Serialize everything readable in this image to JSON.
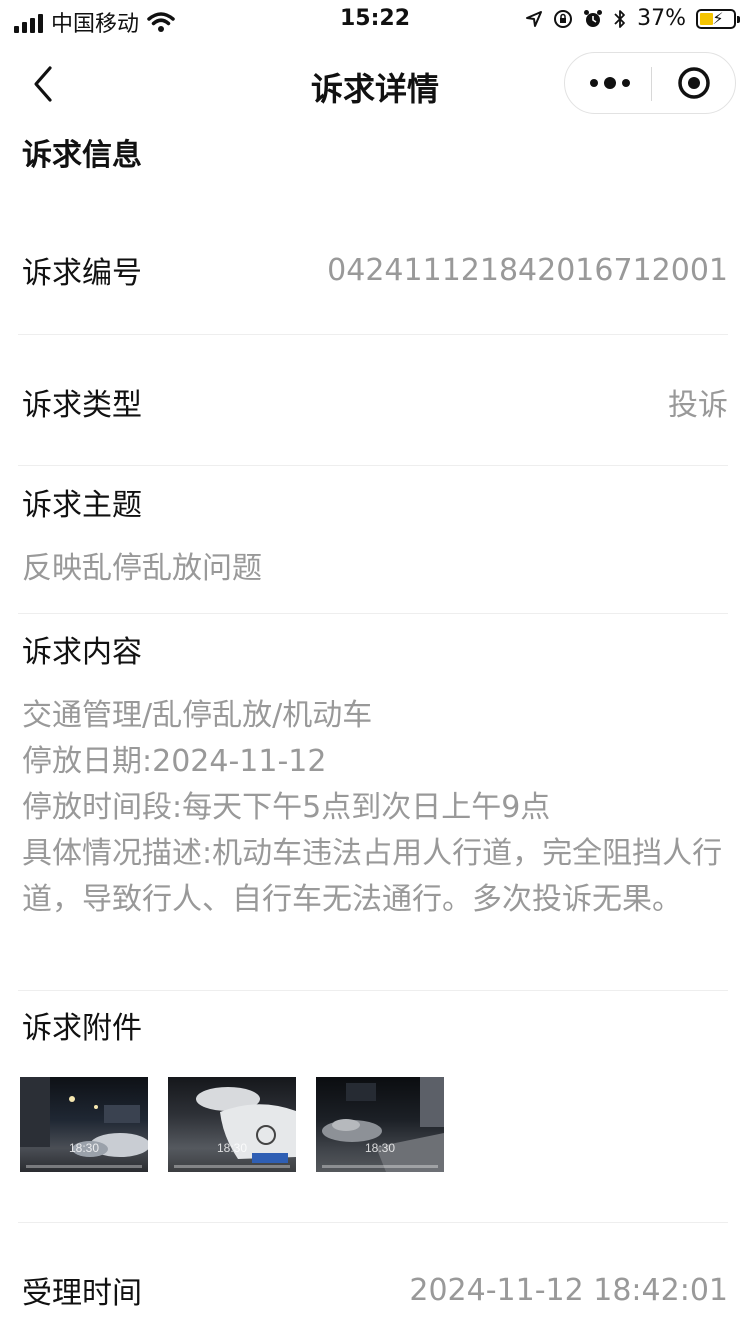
{
  "status_bar": {
    "carrier": "中国移动",
    "time": "15:22",
    "battery": "37%"
  },
  "nav": {
    "title": "诉求详情"
  },
  "section": {
    "title": "诉求信息"
  },
  "fields": {
    "number_label": "诉求编号",
    "number_value": "042411121842016712001",
    "type_label": "诉求类型",
    "type_value": "投诉",
    "theme_label": "诉求主题",
    "theme_value": "反映乱停乱放问题",
    "content_label": "诉求内容",
    "content_lines": [
      "交通管理/乱停乱放/机动车",
      "停放日期:2024-11-12",
      "停放时间段:每天下午5点到次日上午9点",
      "具体情况描述:机动车违法占用人行道，完全阻挡人行道，导致行人、自行车无法通行。多次投诉无果。"
    ],
    "attachments_label": "诉求附件",
    "accept_time_label": "受理时间",
    "accept_time_value": "2024-11-12 18:42:01"
  },
  "attachments": [
    {
      "time": "18:30"
    },
    {
      "time": "18:30"
    },
    {
      "time": "18:30"
    }
  ],
  "colors": {
    "label": "#111111",
    "value": "#999999",
    "separator": "#eeeeee",
    "battery_fill": "#f5c400"
  }
}
